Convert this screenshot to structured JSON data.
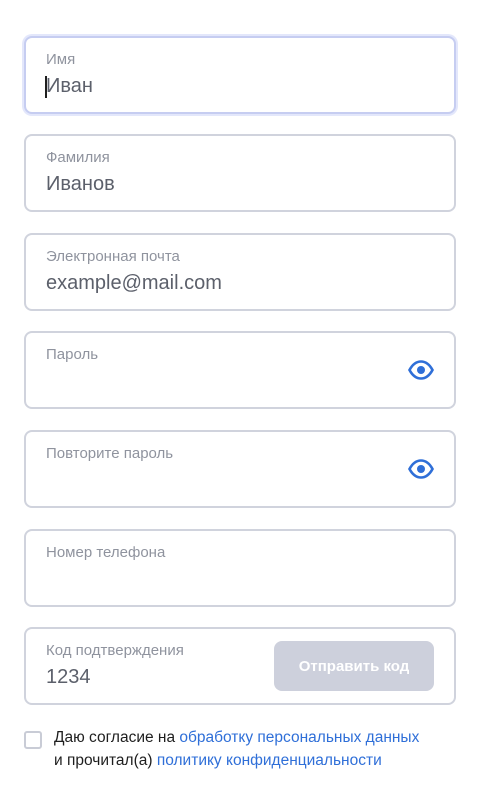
{
  "fields": {
    "first_name": {
      "label": "Имя",
      "value": "Иван"
    },
    "last_name": {
      "label": "Фамилия",
      "value": "Иванов"
    },
    "email": {
      "label": "Электронная почта",
      "value": "example@mail.com"
    },
    "password": {
      "label": "Пароль",
      "value": "",
      "icon": "eye-icon"
    },
    "password_repeat": {
      "label": "Повторите пароль",
      "value": "",
      "icon": "eye-icon"
    },
    "phone": {
      "label": "Номер телефона",
      "value": ""
    },
    "code": {
      "label": "Код подтверждения",
      "value": "1234",
      "send_button": "Отправить код"
    }
  },
  "consent": {
    "text_1": "Даю согласие на",
    "link_1": "обработку персональных данных",
    "text_2": "и прочитал(а)",
    "link_2": "политику конфиденциальности",
    "checked": false
  },
  "colors": {
    "accent": "#2f6fd8",
    "border": "#d0d3dd",
    "focus_border": "#c6cdf1",
    "button_disabled": "#cdd0dc"
  }
}
